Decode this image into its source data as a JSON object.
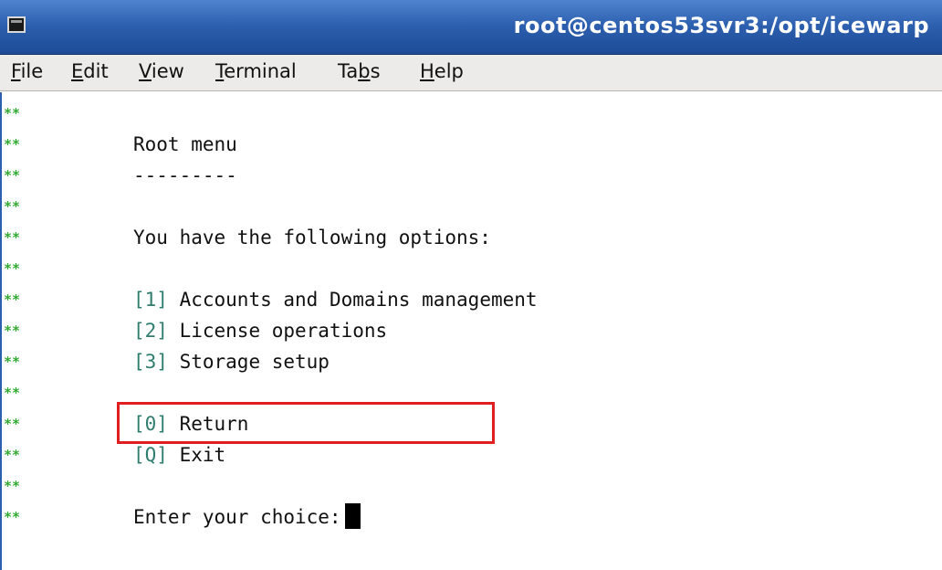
{
  "window": {
    "title": "root@centos53svr3:/opt/icewarp",
    "icon": "terminal-icon"
  },
  "menubar": [
    {
      "pre": "",
      "ul": "F",
      "post": "ile"
    },
    {
      "pre": "",
      "ul": "E",
      "post": "dit"
    },
    {
      "pre": "",
      "ul": "V",
      "post": "iew"
    },
    {
      "pre": "",
      "ul": "T",
      "post": "erminal"
    },
    {
      "pre": "Ta",
      "ul": "b",
      "post": "s"
    },
    {
      "pre": "",
      "ul": "H",
      "post": "elp"
    }
  ],
  "terminal": {
    "prefix": "**",
    "menu_title": "Root menu",
    "underline": "---------",
    "intro": "You have the following options:",
    "options": [
      {
        "key": "[1]",
        "label": "Accounts and Domains management"
      },
      {
        "key": "[2]",
        "label": "License operations"
      },
      {
        "key": "[3]",
        "label": "Storage setup"
      },
      {
        "key": "[0]",
        "label": "Return"
      },
      {
        "key": "[Q]",
        "label": "Exit"
      }
    ],
    "prompt": "Enter your choice:"
  },
  "colors": {
    "titlebar": "#2c5fae",
    "prefix": "#33aa33",
    "bracket": "#2f7d6e",
    "highlight": "#e02020"
  }
}
